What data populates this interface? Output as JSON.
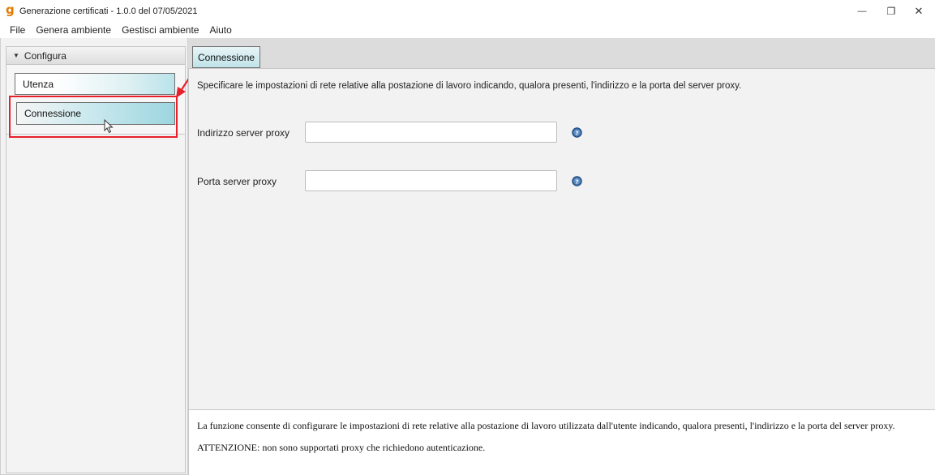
{
  "window": {
    "app_icon_glyph": "g",
    "title": "Generazione certificati - 1.0.0 del 07/05/2021",
    "minimize_glyph": "—",
    "restore_glyph": "❐",
    "close_glyph": "✕"
  },
  "menu": {
    "items": [
      "File",
      "Genera ambiente",
      "Gestisci ambiente",
      "Aiuto"
    ]
  },
  "sidebar": {
    "section_arrow": "▼",
    "section_title": "Configura",
    "items": [
      {
        "label": "Utenza"
      },
      {
        "label": "Connessione",
        "selected": true
      }
    ]
  },
  "main": {
    "tab_label": "Connessione",
    "description": "Specificare le impostazioni di rete relative alla postazione di lavoro indicando, qualora presenti, l'indirizzo e la porta del server proxy.",
    "fields": [
      {
        "label": "Indirizzo server proxy",
        "value": "",
        "help_icon": "question-circle-icon"
      },
      {
        "label": "Porta server proxy",
        "value": "",
        "help_icon": "question-circle-icon"
      }
    ]
  },
  "info": {
    "text": "La funzione consente di configurare le impostazioni di rete relative alla postazione di lavoro utilizzata dall'utente indicando, qualora presenti, l'indirizzo e la porta del server proxy.",
    "warning": "ATTENZIONE: non sono supportati proxy che richiedono autenticazione."
  },
  "colors": {
    "highlight": "#e8202a",
    "selected_gradient_end": "#9dd6df",
    "help_icon": "#2d5f97"
  }
}
